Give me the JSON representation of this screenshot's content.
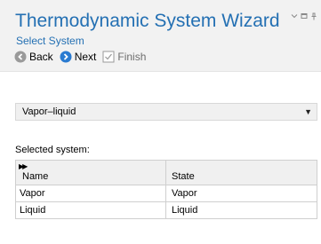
{
  "window": {
    "title": "Thermodynamic System Wizard",
    "subtitle": "Select System"
  },
  "toolbar": {
    "back_label": "Back",
    "next_label": "Next",
    "finish_label": "Finish"
  },
  "system_type": {
    "selected": "Vapor–liquid"
  },
  "selected_system": {
    "label": "Selected system:",
    "columns": [
      "Name",
      "State"
    ],
    "rows": [
      {
        "name": "Vapor",
        "state": "Vapor"
      },
      {
        "name": "Liquid",
        "state": "Liquid"
      }
    ]
  },
  "icons": {
    "back": "back-arrow-icon",
    "next": "next-arrow-icon",
    "finish": "checkbox-icon",
    "window_menu": "chevron-down-icon",
    "restore": "restore-icon",
    "pin": "pin-icon"
  },
  "colors": {
    "accent": "#2470b3",
    "header_bg": "#f2f2f2"
  }
}
